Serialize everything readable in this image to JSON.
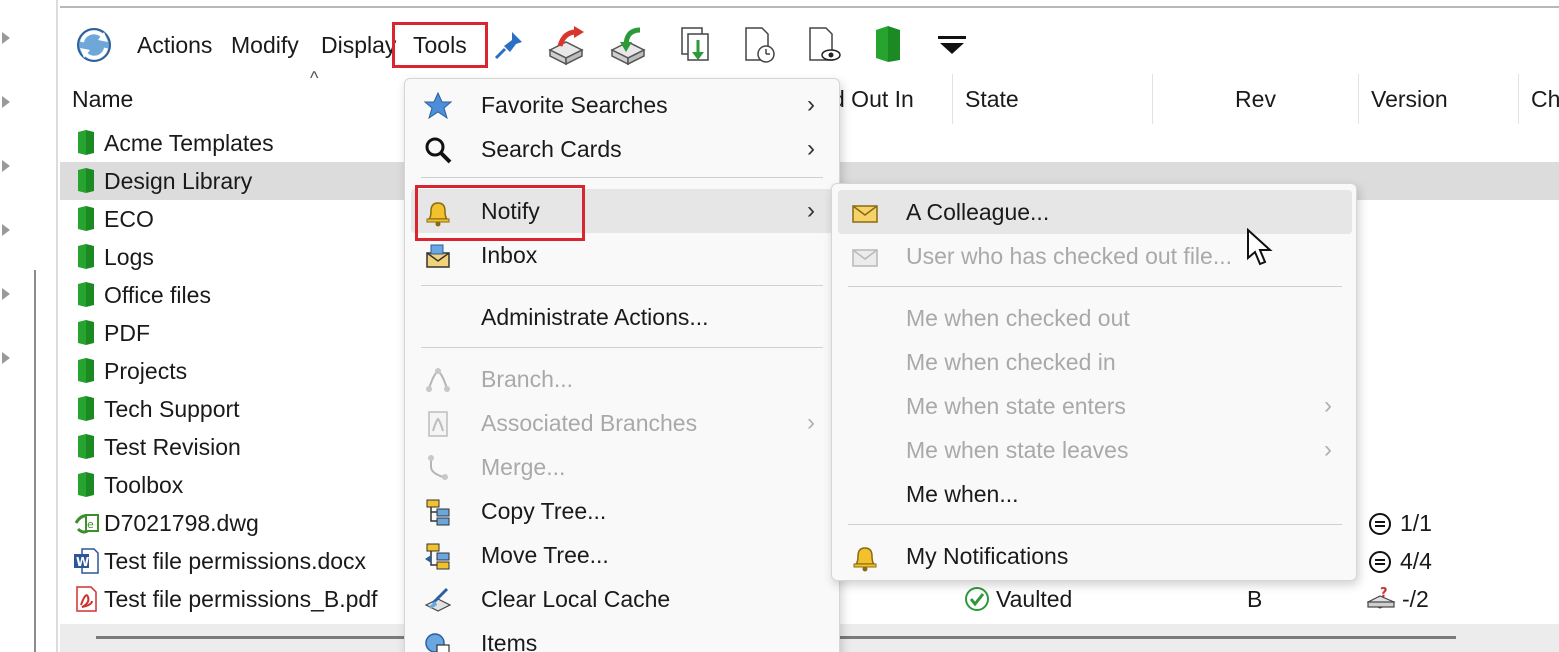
{
  "toolbar": {
    "menus": [
      {
        "label": "Actions"
      },
      {
        "label": "Modify"
      },
      {
        "label": "Display"
      },
      {
        "label": "Tools"
      }
    ]
  },
  "columns": [
    {
      "label": "Name"
    },
    {
      "label": "d Out In"
    },
    {
      "label": "State"
    },
    {
      "label": "Rev"
    },
    {
      "label": "Version"
    },
    {
      "label": "Ch"
    }
  ],
  "rows": [
    {
      "name": "Acme Templates",
      "type": "folder"
    },
    {
      "name": "Design Library",
      "type": "folder",
      "selected": true
    },
    {
      "name": "ECO",
      "type": "folder"
    },
    {
      "name": "Logs",
      "type": "folder"
    },
    {
      "name": "Office files",
      "type": "folder"
    },
    {
      "name": "PDF",
      "type": "folder"
    },
    {
      "name": "Projects",
      "type": "folder"
    },
    {
      "name": "Tech Support",
      "type": "folder"
    },
    {
      "name": "Test Revision",
      "type": "folder"
    },
    {
      "name": "Toolbox",
      "type": "folder"
    },
    {
      "name": "D7021798.dwg",
      "type": "dwg",
      "version": "1/1"
    },
    {
      "name": "Test file permissions.docx",
      "type": "docx",
      "version": "4/4"
    },
    {
      "name": "Test file permissions_B.pdf",
      "type": "pdf",
      "state": "Vaulted",
      "rev": "B",
      "version": "-/2"
    }
  ],
  "tools_menu": {
    "items": [
      {
        "label": "Favorite Searches",
        "icon": "star-icon",
        "submenu": true
      },
      {
        "label": "Search Cards",
        "icon": "search-icon",
        "submenu": true
      },
      {
        "label": "Notify",
        "icon": "bell-icon",
        "submenu": true
      },
      {
        "label": "Inbox",
        "icon": "inbox-icon"
      },
      {
        "label": "Administrate Actions...",
        "icon": ""
      },
      {
        "label": "Branch...",
        "icon": "branch-icon",
        "disabled": true
      },
      {
        "label": "Associated Branches",
        "icon": "associated-branches-icon",
        "disabled": true,
        "submenu": true
      },
      {
        "label": "Merge...",
        "icon": "merge-icon",
        "disabled": true
      },
      {
        "label": "Copy Tree...",
        "icon": "copy-tree-icon"
      },
      {
        "label": "Move Tree...",
        "icon": "move-tree-icon"
      },
      {
        "label": "Clear Local Cache",
        "icon": "clear-cache-icon"
      },
      {
        "label": "Items",
        "icon": "items-icon"
      }
    ]
  },
  "notify_menu": {
    "items": [
      {
        "label": "A Colleague...",
        "icon": "envelope-icon"
      },
      {
        "label": "User who has checked out file...",
        "icon": "envelope-icon",
        "disabled": true
      },
      {
        "label": "Me when checked out",
        "disabled": true
      },
      {
        "label": "Me when checked in",
        "disabled": true
      },
      {
        "label": "Me when state enters",
        "disabled": true,
        "submenu": true
      },
      {
        "label": "Me when state leaves",
        "disabled": true,
        "submenu": true
      },
      {
        "label": "Me when..."
      },
      {
        "label": "My Notifications",
        "icon": "bell-icon"
      }
    ]
  },
  "glyphs": {
    "submenu_arrow": "›",
    "sort_caret": "^"
  },
  "colors": {
    "highlight_border": "#d9252f",
    "folder_green": "#1f9d2c",
    "menu_bg": "#f9f9f9",
    "selected_row": "#dcdcdc"
  }
}
